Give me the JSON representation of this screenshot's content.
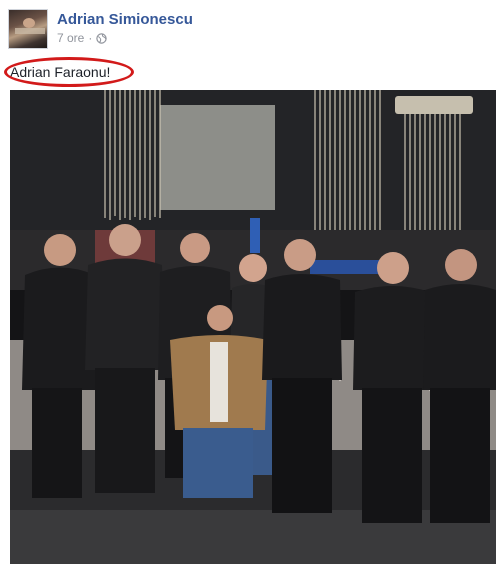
{
  "post": {
    "author_name": "Adrian Simionescu",
    "time": "7 ore",
    "separator": "·",
    "privacy_icon": "globe-icon",
    "caption": "Adrian Faraonu!",
    "annotation_color": "#d21a1a",
    "author_color": "#365899"
  }
}
